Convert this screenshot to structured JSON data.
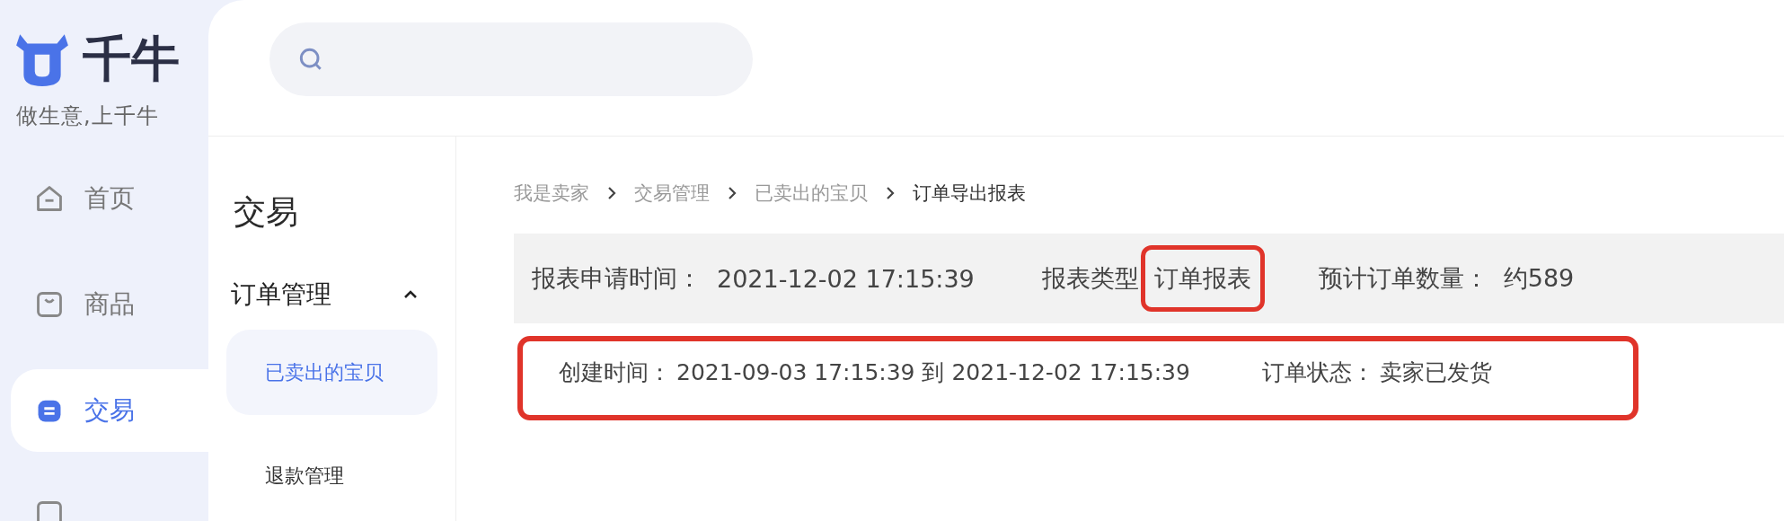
{
  "brand": {
    "name": "千牛",
    "slogan": "做生意,上千牛"
  },
  "nav": [
    {
      "label": "首页",
      "selected": false
    },
    {
      "label": "商品",
      "selected": false
    },
    {
      "label": "交易",
      "selected": true
    }
  ],
  "subnav": {
    "title": "交易",
    "groups": [
      {
        "label": "订单管理",
        "expanded": true,
        "children": [
          {
            "label": "已卖出的宝贝",
            "selected": true
          }
        ]
      },
      {
        "label": "退款管理"
      }
    ]
  },
  "breadcrumb": [
    {
      "label": "我是卖家",
      "current": false
    },
    {
      "label": "交易管理",
      "current": false
    },
    {
      "label": "已卖出的宝贝",
      "current": false
    },
    {
      "label": "订单导出报表",
      "current": true
    }
  ],
  "summary": [
    {
      "label": "报表申请时间：",
      "value": "2021-12-02 17:15:39",
      "highlighted": false
    },
    {
      "label": "报表类型",
      "value": "订单报表",
      "highlighted": true
    },
    {
      "label": "预计订单数量：",
      "value": "约589",
      "highlighted": false
    }
  ],
  "filters": {
    "highlighted": true,
    "items": [
      {
        "label": "创建时间：",
        "value": "2021-09-03 17:15:39 到 2021-12-02 17:15:39"
      },
      {
        "label": "订单状态：",
        "value": "卖家已发货"
      }
    ]
  }
}
